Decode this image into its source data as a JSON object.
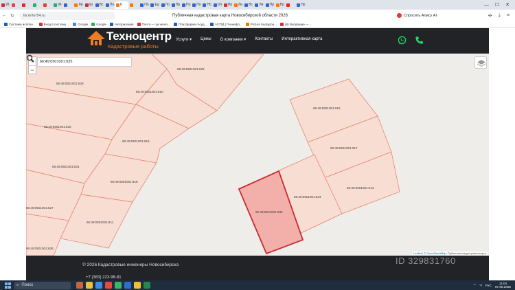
{
  "browser": {
    "tabs": [
      {
        "label": "28",
        "color": "#c33"
      },
      {
        "label": "",
        "color": "#d44"
      },
      {
        "label": "",
        "color": "#e22"
      },
      {
        "label": "",
        "color": "#3a6"
      },
      {
        "label": "",
        "color": "#d42"
      },
      {
        "label": "96",
        "color": "#2a7"
      },
      {
        "label": "",
        "color": "#36c"
      },
      {
        "label": "Ли",
        "color": "#f70"
      },
      {
        "label": "пр",
        "color": "#c33"
      },
      {
        "label": "Вс",
        "color": "#36c"
      },
      {
        "label": "По",
        "color": "#36c"
      },
      {
        "label": "",
        "color": "#f70"
      },
      {
        "label": "По",
        "color": "#36c"
      },
      {
        "label": "Ед",
        "color": "#36c"
      },
      {
        "label": "По",
        "color": "#36c"
      },
      {
        "label": "Пр",
        "color": "#36c"
      },
      {
        "label": "По",
        "color": "#36c"
      },
      {
        "label": "По",
        "color": "#36c"
      },
      {
        "label": "НС",
        "color": "#36c"
      },
      {
        "label": "Оп",
        "color": "#36c"
      },
      {
        "label": "Пр",
        "color": "#c33"
      },
      {
        "label": "Ли",
        "color": "#f70"
      },
      {
        "label": "Вс",
        "color": "#36c"
      },
      {
        "label": "Ли",
        "color": "#36c"
      },
      {
        "label": "Пр",
        "color": "#36c"
      },
      {
        "label": "Пр",
        "color": "#f70"
      },
      {
        "label": "",
        "color": "#e22"
      },
      {
        "label": "Пр",
        "color": "#36c"
      }
    ],
    "active_tab_label": "К",
    "url": "tkcenter54.ru",
    "page_title": "Публичная кадастровая карта Новосибирской области 2026",
    "alice_label": "Спросить Алису AI",
    "bookmarks": [
      {
        "label": "Система исполн...",
        "color": "#1b5fa8"
      },
      {
        "label": "Вход в систему ...",
        "color": "#c33"
      },
      {
        "label": "Google",
        "color": "#4285f4"
      },
      {
        "label": "Google",
        "color": "#34a853"
      },
      {
        "label": "Авторизация",
        "color": "#1b5fa8"
      },
      {
        "label": "Почта — ya.veren...",
        "color": "#c33"
      },
      {
        "label": "Платформа госуд...",
        "color": "#1b5fa8"
      },
      {
        "label": "НСПД | Геоинфо...",
        "color": "#1b5fa8"
      },
      {
        "label": "Picture backgrou...",
        "color": "#e07b00"
      },
      {
        "label": "(6) Входящие — ...",
        "color": "#c33"
      }
    ]
  },
  "site": {
    "logo_title": "Техноцентр",
    "logo_subtitle": "Кадастровые работы",
    "nav": [
      "Услуги ▾",
      "Цены",
      "О компании ▾",
      "Контакты",
      "Интерактивная карта"
    ],
    "footer_copyright": "© 2026 Кадастровые инженеры Новосибирска",
    "footer_phone": "+7 (383) 223-96-81"
  },
  "map": {
    "search_value": "66:49:0501001:635",
    "zoom_in": "+",
    "zoom_out": "−",
    "attribution_leaflet": "Leaflet",
    "attribution_osm": "OpenStreetMap",
    "attribution_pkk": "Публичная кадастровая карта",
    "parcels": [
      {
        "id": "p623",
        "label": "66:49:0501001:623"
      },
      {
        "id": "p629",
        "label": "66:49:0501001:629"
      },
      {
        "id": "p610",
        "label": "66:49:0501001:610"
      },
      {
        "id": "p630",
        "label": "66:49:0501001:630"
      },
      {
        "id": "p616",
        "label": "66:49:0501001:616"
      },
      {
        "id": "p631",
        "label": "66:49:0501001:631"
      },
      {
        "id": "p618",
        "label": "66:49:0501001:618"
      },
      {
        "id": "p627",
        "label": "66:49:0501001:627"
      },
      {
        "id": "p611",
        "label": "66:49:0501001:611"
      },
      {
        "id": "p628",
        "label": "66:49:0501001:628"
      },
      {
        "id": "p615",
        "label": "66:49:0501001:615"
      },
      {
        "id": "p617",
        "label": "66:49:0501001:617"
      },
      {
        "id": "p613",
        "label": "66:49:0501001:613"
      },
      {
        "id": "p634",
        "label": "66:49:0501001:634"
      },
      {
        "id": "p635",
        "label": "66:49:0501001:635",
        "selected": true
      }
    ],
    "colors": {
      "parcel_fill": "#f7ddd2",
      "parcel_line": "#e8856e",
      "selected_fill": "#f3b0ab",
      "selected_line": "#c92a2a",
      "background": "#efede9"
    }
  },
  "watermark": "ID 329831760",
  "taskbar": {
    "search_placeholder": "Поиск",
    "lang": "РУС",
    "time": "11:04",
    "date": "07.05.2026"
  }
}
